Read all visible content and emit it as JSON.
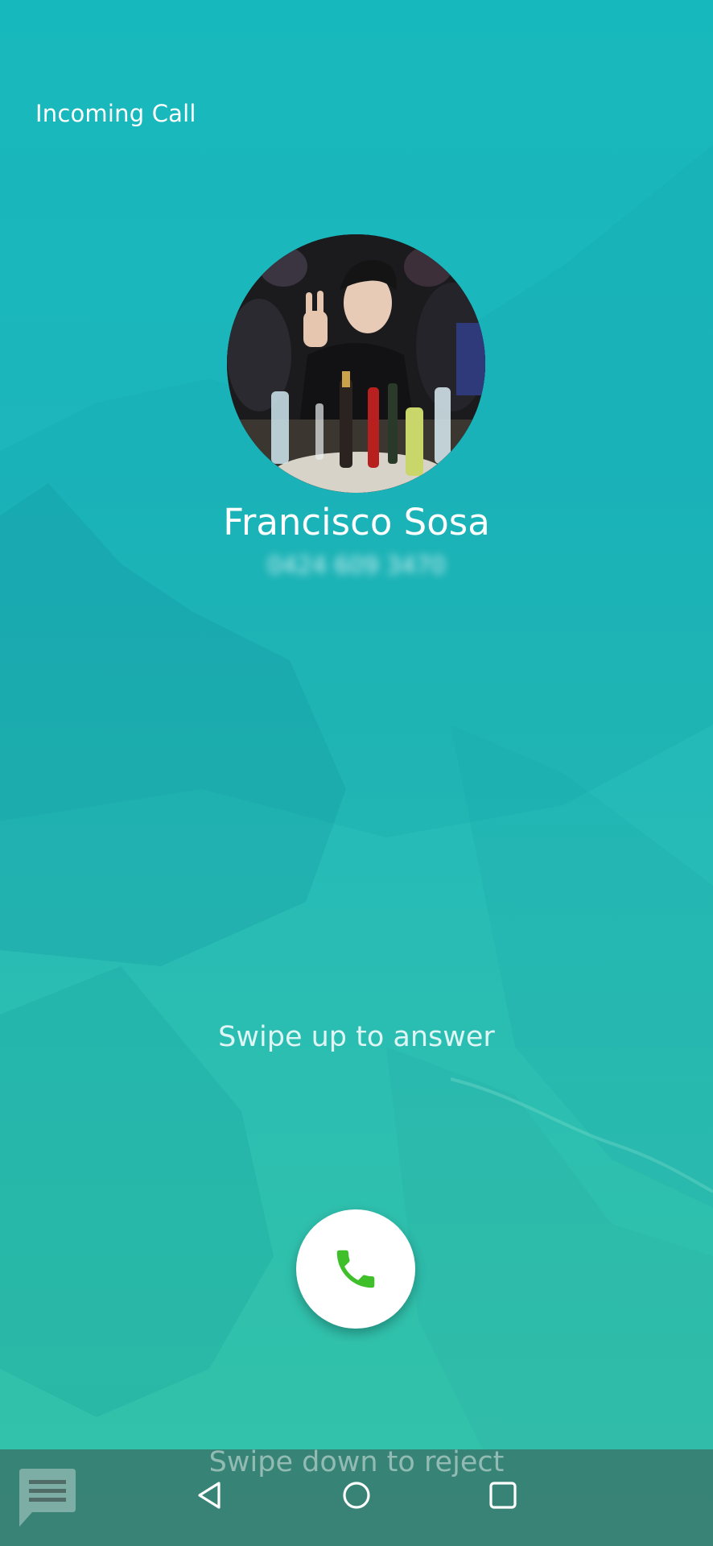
{
  "call": {
    "status_label": "Incoming Call",
    "caller_name": "Francisco Sosa",
    "caller_number": "0424 609 3470"
  },
  "actions": {
    "swipe_answer_hint": "Swipe up to answer",
    "swipe_reject_hint": "Swipe down to reject",
    "answer_icon": "phone-icon",
    "message_icon": "message-icon"
  },
  "nav": {
    "back_icon": "back-triangle-icon",
    "home_icon": "home-circle-icon",
    "recents_icon": "recents-square-icon"
  },
  "colors": {
    "background_top": "#17b8bd",
    "background_bottom": "#33c2a8",
    "answer_icon": "#3fbf2a",
    "text": "#ffffff"
  }
}
